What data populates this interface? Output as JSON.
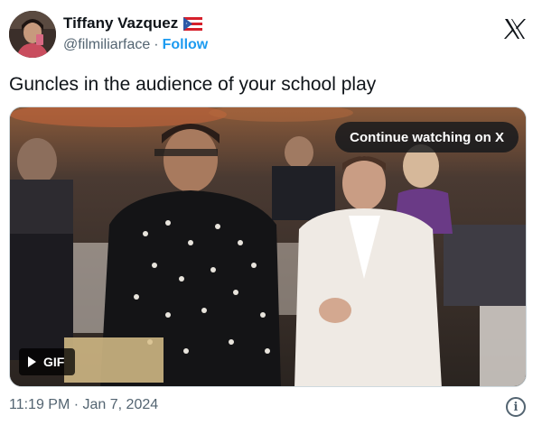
{
  "author": {
    "display_name": "Tiffany Vazquez",
    "handle": "@filmiliarface",
    "separator": "·",
    "follow_label": "Follow",
    "flag_icon": "puerto-rico-flag-icon",
    "avatar_icon": "profile-avatar"
  },
  "platform_icon": "x-logo-icon",
  "tweet": {
    "text": "Guncles in the audience of your school play"
  },
  "media": {
    "continue_label": "Continue watching on X",
    "gif_label": "GIF",
    "play_icon": "play-icon"
  },
  "footer": {
    "timestamp": "11:19 PM · Jan 7, 2024",
    "info_icon": "info-icon"
  },
  "colors": {
    "link": "#1d9bf0",
    "secondary_text": "#536471",
    "primary_text": "#0f1419"
  }
}
